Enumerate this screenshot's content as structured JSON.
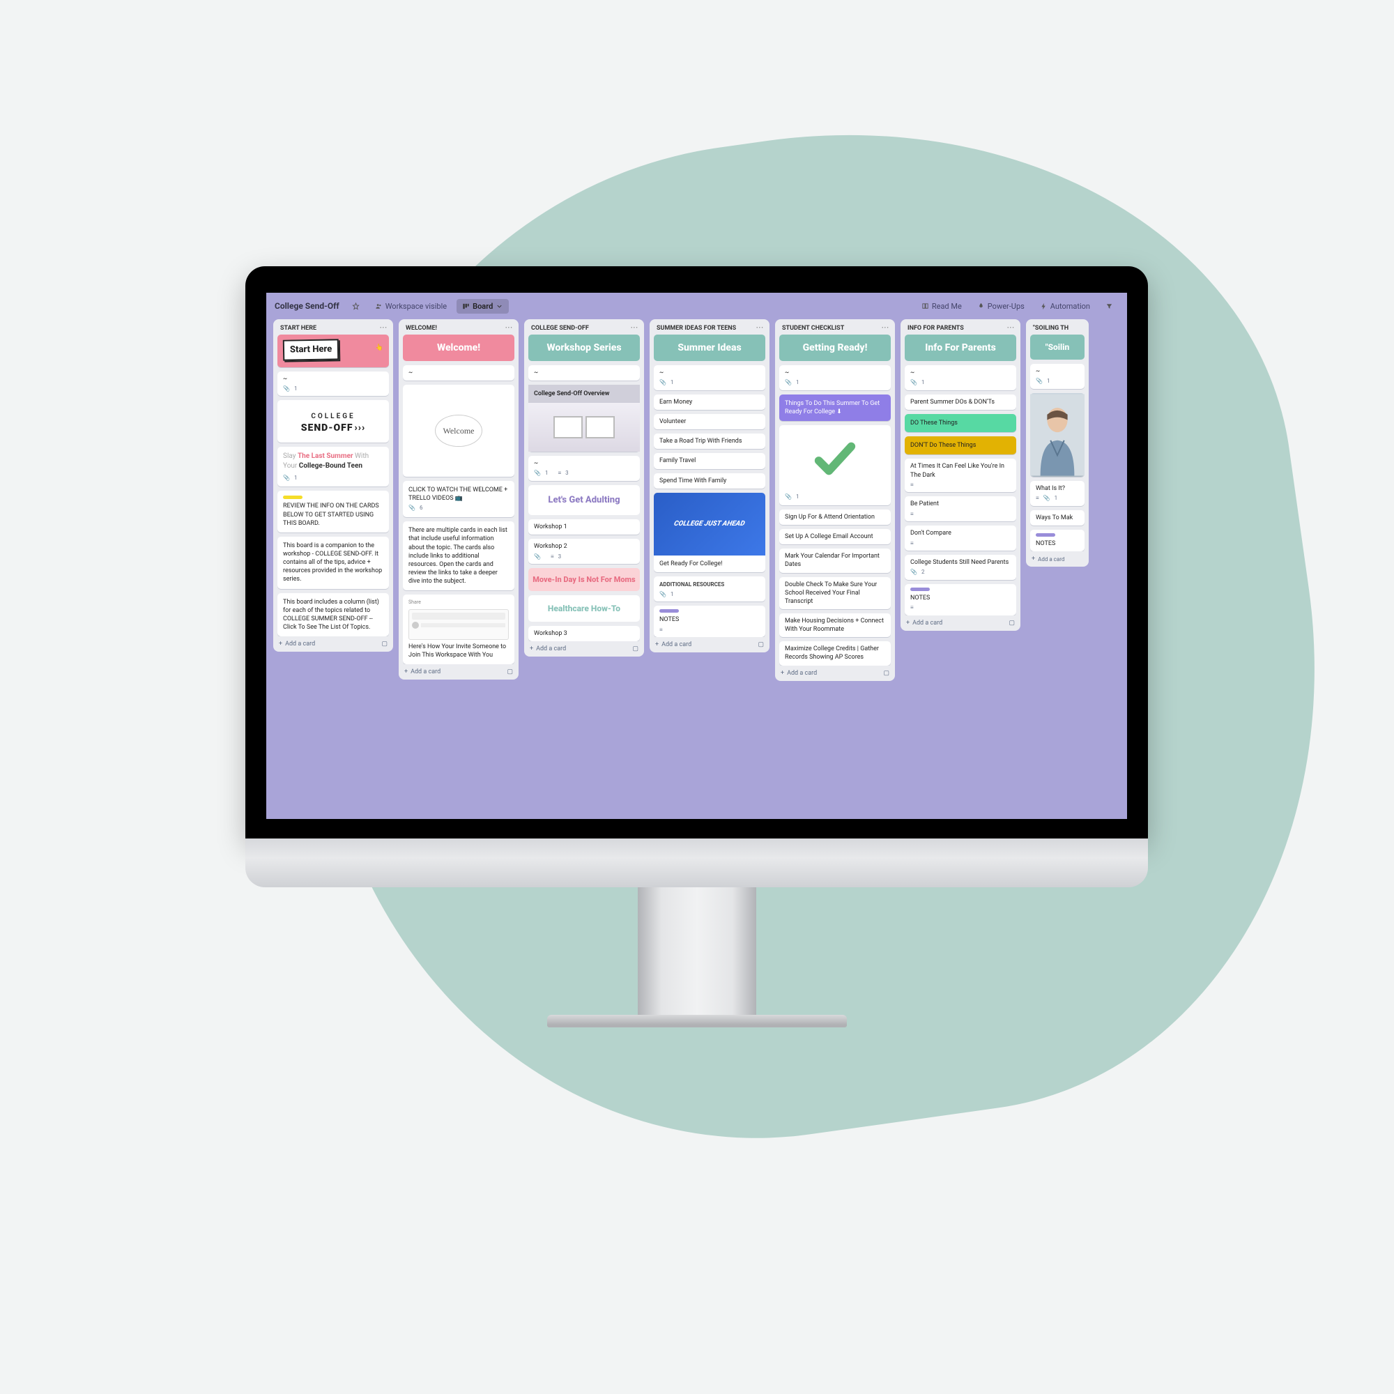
{
  "header": {
    "board_title": "College Send-Off",
    "workspace_visible": "Workspace visible",
    "board_btn": "Board",
    "read_me": "Read Me",
    "power_ups": "Power-Ups",
    "automation": "Automation"
  },
  "add_card": "Add a card",
  "lists": {
    "start_here": {
      "title": "START HERE",
      "start_tag": "Start Here",
      "att1": "1",
      "logo_top": "COLLEGE",
      "logo_bottom": "SEND-OFF",
      "slay_gray1": "Slay ",
      "slay_pink": "The Last Summer",
      "slay_gray2": " With Your ",
      "slay_dark": "College-Bound Teen",
      "slay_att": "1",
      "review": "REVIEW THE INFO ON THE CARDS BELOW TO GET STARTED USING THIS BOARD.",
      "companion": "This board is a companion to the workshop - COLLEGE SEND-OFF. It contains all of the tips, advice + resources provided in the workshop series.",
      "includes": "This board includes a column (list) for each of the topics related to COLLEGE SUMMER SEND-OFF -- Click To See The List Of Topics."
    },
    "welcome": {
      "title": "WELCOME!",
      "banner": "Welcome!",
      "floral_center": "Welcome",
      "click_watch": "CLICK TO WATCH THE WELCOME + TRELLO VIDEOS 📺",
      "click_att": "6",
      "explain": "There are multiple cards in each list that include useful information about the topic. The cards also include links to additional resources. Open the cards and review the links to take a deeper dive into the subject.",
      "share_label": "Share",
      "invite": "Here's How Your Invite Someone to Join This Workspace With You"
    },
    "sendoff": {
      "title": "COLLEGE SEND-OFF",
      "banner": "Workshop Series",
      "overview": "College Send-Off Overview",
      "ov_att": "1",
      "ov_att2": "3",
      "adulting": "Let's Get Adulting",
      "ws1": "Workshop 1",
      "ws2": "Workshop 2",
      "ws2_att": "3",
      "movein": "Move-In Day Is Not For Moms",
      "healthcare": "Healthcare How-To",
      "ws3": "Workshop 3"
    },
    "summer": {
      "title": "SUMMER IDEAS FOR TEENS",
      "banner": "Summer Ideas",
      "att1": "1",
      "earn": "Earn Money",
      "volunteer": "Volunteer",
      "roadtrip": "Take a Road Trip With Friends",
      "family_travel": "Family Travel",
      "spend_time": "Spend Time With Family",
      "img_text": "COLLEGE JUST AHEAD",
      "get_ready": "Get Ready For College!",
      "additional": "ADDITIONAL RESOURCES",
      "add_att": "1",
      "notes": "NOTES"
    },
    "checklist": {
      "title": "STUDENT CHECKLIST",
      "banner": "Getting Ready!",
      "att1": "1",
      "things_to_do": "Things To Do This Summer To Get Ready For College ⬇",
      "check_att": "1",
      "signup": "Sign Up For & Attend Orientation",
      "email": "Set Up A College Email Account",
      "calendar": "Mark Your Calendar For Important Dates",
      "transcript": "Double Check To Make Sure Your School Received Your Final Transcript",
      "housing": "Make Housing Decisions + Connect With Your Roommate",
      "maximize": "Maximize College Credits | Gather Records Showing AP Scores"
    },
    "parents": {
      "title": "INFO FOR PARENTS",
      "banner": "Info For Parents",
      "att1": "1",
      "dos_donts": "Parent Summer DOs & DON'Ts",
      "do_these": "DO These Things",
      "dont_these": "DON'T Do These Things",
      "dark": "At Times It Can Feel Like You're In The Dark",
      "patient": "Be Patient",
      "compare": "Don't Compare",
      "still_need": "College Students Still Need Parents",
      "still_att": "2",
      "notes": "NOTES"
    },
    "soiling": {
      "title": "\"SOILING TH",
      "banner": "\"Soilin",
      "att1": "1",
      "what": "What Is It?",
      "what_att": "1",
      "ways": "Ways To Mak",
      "notes": "NOTES"
    }
  }
}
